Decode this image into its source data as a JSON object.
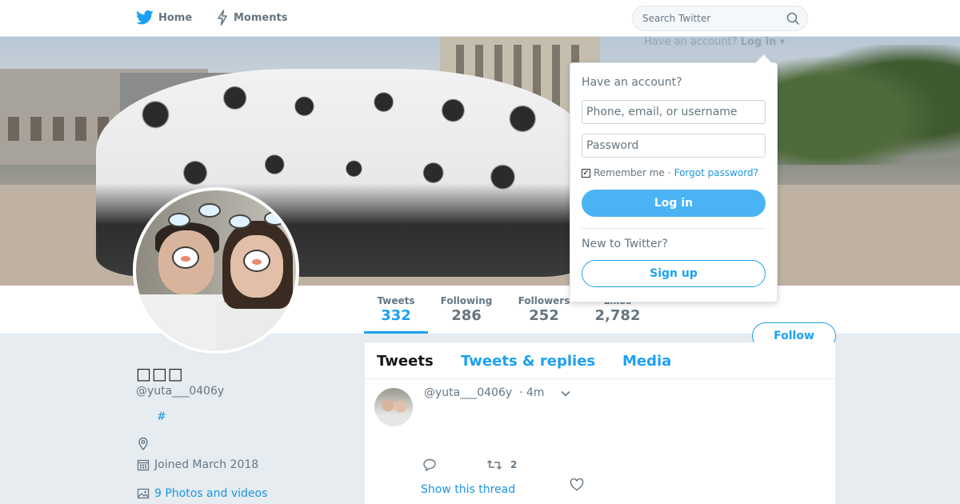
{
  "nav": {
    "home_label": "Home",
    "moments_label": "Moments",
    "search_placeholder": "Search Twitter"
  },
  "login_hint": {
    "prefix": "Have an account?",
    "link": "Log in"
  },
  "login_dropdown": {
    "title": "Have an account?",
    "username_placeholder": "Phone, email, or username",
    "password_placeholder": "Password",
    "remember_label": "Remember me",
    "separator": "·",
    "forgot_label": "Forgot password?",
    "login_button": "Log in",
    "new_label": "New to Twitter?",
    "signup_button": "Sign up"
  },
  "stats": [
    {
      "label": "Tweets",
      "value": "332"
    },
    {
      "label": "Following",
      "value": "286"
    },
    {
      "label": "Followers",
      "value": "252"
    },
    {
      "label": "Likes",
      "value": "2,782"
    }
  ],
  "follow_button": "Follow",
  "profile": {
    "name": "□□□",
    "handle": "@yuta___0406y",
    "hashtag": "#",
    "joined": "Joined March 2018",
    "photos": "9 Photos and videos"
  },
  "timeline": {
    "tabs": [
      "Tweets",
      "Tweets & replies",
      "Media"
    ],
    "tweet": {
      "handle": "@yuta___0406y",
      "time": "· 4m",
      "retweet_count": "2",
      "show_thread": "Show this thread"
    }
  },
  "colors": {
    "brand": "#1da1f2",
    "link": "#1b95e0",
    "muted": "#657786",
    "background": "#e6ecf0"
  },
  "icons": {
    "home": "twitter-bird-icon",
    "moments": "lightning-icon",
    "search": "search-icon",
    "location": "location-pin-icon",
    "calendar": "calendar-icon",
    "photos": "image-icon",
    "reply": "reply-icon",
    "retweet": "retweet-icon",
    "like": "heart-icon",
    "caret": "chevron-down-icon"
  }
}
